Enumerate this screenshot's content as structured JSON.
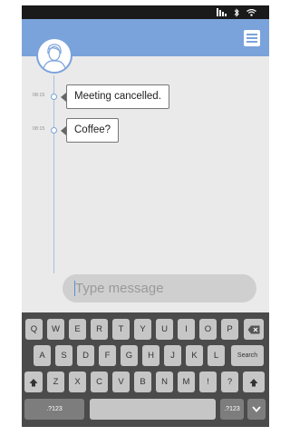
{
  "messages": [
    {
      "time": "08:15",
      "text": "Meeting cancelled."
    },
    {
      "time": "08:15",
      "text": "Coffee?"
    }
  ],
  "composer": {
    "placeholder": "Type message"
  },
  "keyboard": {
    "row1": [
      "Q",
      "W",
      "E",
      "R",
      "T",
      "Y",
      "U",
      "I",
      "O",
      "P"
    ],
    "row2": [
      "A",
      "S",
      "D",
      "F",
      "G",
      "H",
      "J",
      "K",
      "L"
    ],
    "row3": [
      "Z",
      "X",
      "C",
      "V",
      "B",
      "N",
      "M",
      "!",
      "?"
    ],
    "search_label": "Search",
    "symbols_label": ".?123"
  },
  "colors": {
    "accent": "#7ba3db",
    "status_bar": "#1a1a1a",
    "keyboard_bg": "#4b4b4b",
    "key_light": "#c6c6c6",
    "key_dark": "#7d7d7d"
  },
  "icons": {
    "status": [
      "signal-icon",
      "bluetooth-icon",
      "wifi-icon"
    ],
    "header": "menu-icon",
    "keyboard": [
      "backspace-icon",
      "shift-icon",
      "hide-keyboard-icon"
    ]
  }
}
